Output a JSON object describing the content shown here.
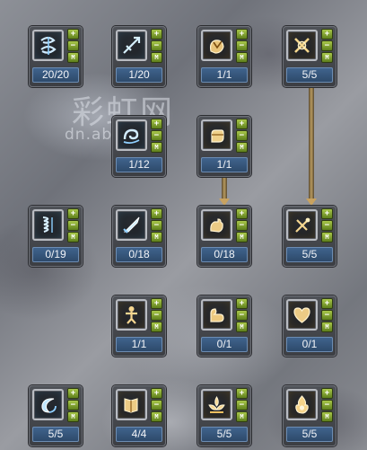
{
  "watermark": {
    "text": "彩虹网",
    "url": "dn.abo"
  },
  "buttons": {
    "plus": "+",
    "minus": "−",
    "master": "M"
  },
  "skills": [
    {
      "id": "r1c1",
      "icon": "whirl-rune-icon",
      "count": "20/20"
    },
    {
      "id": "r1c2",
      "icon": "spear-thrust-icon",
      "count": "1/20"
    },
    {
      "id": "r1c3",
      "icon": "gauntlet-icon",
      "count": "1/1"
    },
    {
      "id": "r1c4",
      "icon": "cross-slash-icon",
      "count": "5/5"
    },
    {
      "id": "r2c2",
      "icon": "wave-swirl-icon",
      "count": "1/12"
    },
    {
      "id": "r2c3",
      "icon": "fist-icon",
      "count": "1/1"
    },
    {
      "id": "r3c1",
      "icon": "spiral-spring-icon",
      "count": "0/19"
    },
    {
      "id": "r3c2",
      "icon": "blade-strike-icon",
      "count": "0/18"
    },
    {
      "id": "r3c3",
      "icon": "grip-hand-icon",
      "count": "0/18"
    },
    {
      "id": "r3c4",
      "icon": "staff-cross-icon",
      "count": "5/5"
    },
    {
      "id": "r4c2",
      "icon": "golden-warrior-icon",
      "count": "1/1"
    },
    {
      "id": "r4c3",
      "icon": "flex-arm-icon",
      "count": "0/1"
    },
    {
      "id": "r4c4",
      "icon": "heart-shield-icon",
      "count": "0/1"
    },
    {
      "id": "r5c1",
      "icon": "crescent-wave-icon",
      "count": "5/5"
    },
    {
      "id": "r5c2",
      "icon": "tome-icon",
      "count": "4/4"
    },
    {
      "id": "r5c3",
      "icon": "lotus-flame-icon",
      "count": "5/5"
    },
    {
      "id": "r5c4",
      "icon": "flame-burst-icon",
      "count": "5/5"
    }
  ]
}
